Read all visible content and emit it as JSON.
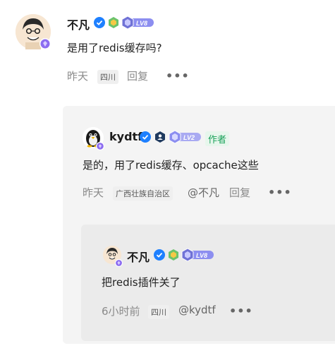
{
  "comment": {
    "author": "不凡",
    "text": "是用了redis缓存吗?",
    "time": "昨天",
    "location": "四川",
    "reply_label": "回复",
    "level": "LV8",
    "more": "•••"
  },
  "reply1": {
    "author": "kydtf",
    "author_badge": "作者",
    "level": "LV2",
    "text": "是的，用了redis缓存、opcache这些",
    "time": "昨天",
    "location": "广西壮族自治区",
    "mention": "@不凡",
    "reply_label": "回复",
    "more": "•••"
  },
  "reply2": {
    "author": "不凡",
    "level": "LV8",
    "text": "把redis插件关了",
    "time": "6小时前",
    "location": "四川",
    "mention": "@kydtf",
    "more": "•••"
  },
  "colors": {
    "verified": "#1e80ff",
    "level_badge": "#8c8ef0",
    "author_tag": "#18a058",
    "panel": "#f4f4f4"
  }
}
